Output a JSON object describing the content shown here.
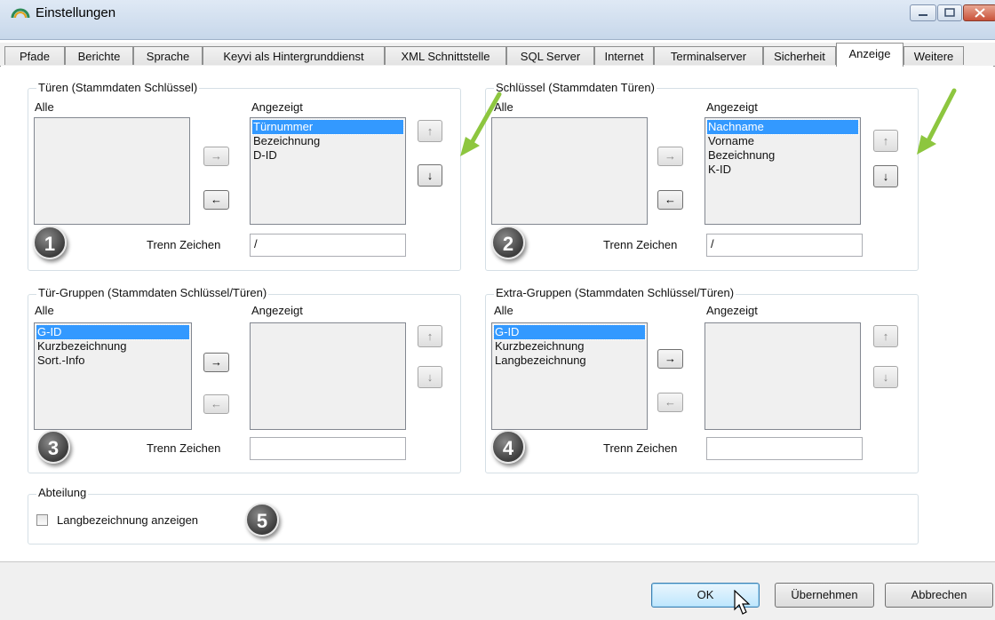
{
  "window": {
    "title": "Einstellungen",
    "icon": "app-arc-icon",
    "controls": [
      "minimize-icon",
      "maximize-icon",
      "close-icon"
    ]
  },
  "tabs": [
    {
      "label": "Pfade",
      "active": false
    },
    {
      "label": "Berichte",
      "active": false
    },
    {
      "label": "Sprache",
      "active": false
    },
    {
      "label": "Keyvi als Hintergrunddienst",
      "active": false
    },
    {
      "label": "XML Schnittstelle",
      "active": false
    },
    {
      "label": "SQL Server",
      "active": false
    },
    {
      "label": "Internet",
      "active": false
    },
    {
      "label": "Terminalserver",
      "active": false
    },
    {
      "label": "Sicherheit",
      "active": false
    },
    {
      "label": "Anzeige",
      "active": true
    },
    {
      "label": "Weitere",
      "active": false
    }
  ],
  "labels": {
    "all": "Alle",
    "shown": "Angezeigt",
    "separator": "Trenn Zeichen"
  },
  "icons": {
    "right": "→",
    "left": "←",
    "up": "↑",
    "down": "↓"
  },
  "groups": [
    {
      "title": "Türen (Stammdaten Schlüssel)",
      "badge": "1",
      "all_items": [],
      "shown_items": [
        "Türnummer",
        "Bezeichnung",
        "D-ID"
      ],
      "selected": "Türnummer",
      "separator": "/"
    },
    {
      "title": "Schlüssel (Stammdaten Türen)",
      "badge": "2",
      "all_items": [],
      "shown_items": [
        "Nachname",
        "Vorname",
        "Bezeichnung",
        "K-ID"
      ],
      "selected": "Nachname",
      "separator": "/"
    },
    {
      "title": "Tür-Gruppen (Stammdaten Schlüssel/Türen)",
      "badge": "3",
      "all_items": [
        "G-ID",
        "Kurzbezeichnung",
        "Sort.-Info"
      ],
      "shown_items": [],
      "selected": "G-ID",
      "separator": ""
    },
    {
      "title": "Extra-Gruppen (Stammdaten Schlüssel/Türen)",
      "badge": "4",
      "all_items": [
        "G-ID",
        "Kurzbezeichnung",
        "Langbezeichnung"
      ],
      "shown_items": [],
      "selected": "G-ID",
      "separator": ""
    }
  ],
  "department": {
    "title": "Abteilung",
    "checkbox_label": "Langbezeichnung anzeigen",
    "checked": false,
    "badge": "5"
  },
  "annotation_color": "#8dc63f",
  "buttons": {
    "ok": "OK",
    "apply": "Übernehmen",
    "cancel": "Abbrechen"
  }
}
